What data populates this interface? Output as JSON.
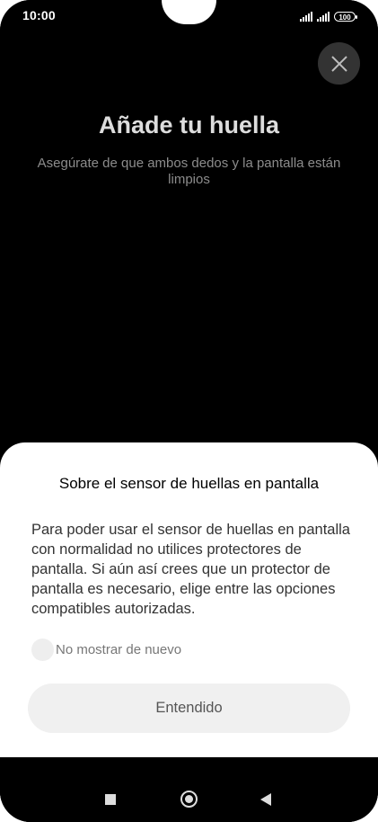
{
  "status_bar": {
    "time": "10:00",
    "battery": "100"
  },
  "page": {
    "title": "Añade tu huella",
    "subtitle": "Asegúrate de que ambos dedos y la pantalla están limpios"
  },
  "dialog": {
    "title": "Sobre el sensor de huellas en pantalla",
    "body": "Para poder usar el sensor de huellas en pantalla con normalidad no utilices protectores de pantalla. Si aún así crees que un protector de pantalla es necesario, elige entre las opciones compatibles autorizadas.",
    "checkbox_label": "No mostrar de nuevo",
    "checkbox_checked": false,
    "button_label": "Entendido"
  },
  "icons": {
    "close": "close-icon",
    "recents": "square-icon",
    "home": "circle-icon",
    "back": "back-triangle-icon"
  },
  "colors": {
    "background": "#000000",
    "sheet": "#ffffff",
    "button": "#f0f0f0"
  }
}
